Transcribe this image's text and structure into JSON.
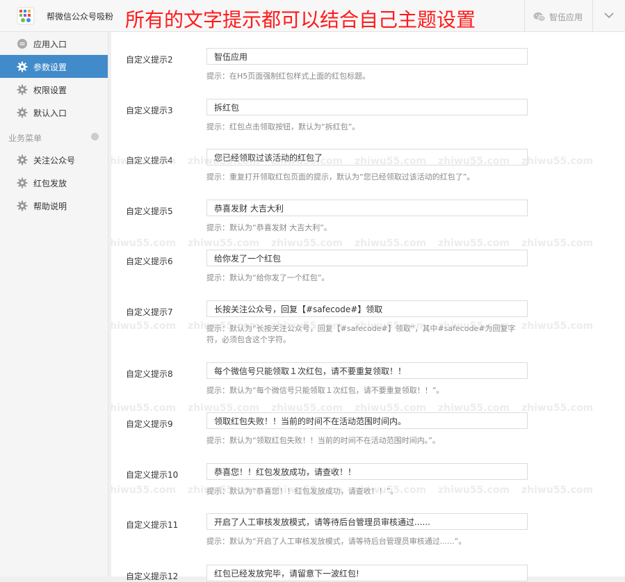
{
  "header": {
    "app_title": "帮微信公众号吸粉",
    "banner": "所有的文字提示都可以结合自己主题设置",
    "account_name": "智伍应用"
  },
  "sidebar": {
    "items": [
      {
        "label": "应用入口",
        "icon": "chat-bubble-icon",
        "active": false
      },
      {
        "label": "参数设置",
        "icon": "gear-icon",
        "active": true
      },
      {
        "label": "权限设置",
        "icon": "gear-icon",
        "active": false
      },
      {
        "label": "默认入口",
        "icon": "gear-icon",
        "active": false
      }
    ],
    "group_title": "业务菜单",
    "group_items": [
      {
        "label": "关注公众号",
        "icon": "gear-icon"
      },
      {
        "label": "红包发放",
        "icon": "gear-icon"
      },
      {
        "label": "帮助说明",
        "icon": "gear-icon"
      }
    ]
  },
  "form": {
    "rows": [
      {
        "label": "自定义提示2",
        "value": "智伍应用",
        "hint": "提示：在H5页面强制红包样式上面的红包标题。"
      },
      {
        "label": "自定义提示3",
        "value": "拆红包",
        "hint": "提示：红包点击领取按钮，默认为“拆红包”。"
      },
      {
        "label": "自定义提示4",
        "value": "您已经领取过该活动的红包了",
        "hint": "提示：重复打开领取红包页面的提示，默认为“您已经领取过该活动的红包了”。"
      },
      {
        "label": "自定义提示5",
        "value": "恭喜发财 大吉大利",
        "hint": "提示：默认为“恭喜发财 大吉大利”。"
      },
      {
        "label": "自定义提示6",
        "value": "给你发了一个红包",
        "hint": "提示：默认为“给你发了一个红包”。"
      },
      {
        "label": "自定义提示7",
        "value": "长按关注公众号，回复【#safecode#】领取",
        "hint": "提示：默认为“长按关注公众号，回复【#safecode#】领取”，其中#safecode#为回复字符，必须包含这个字符。"
      },
      {
        "label": "自定义提示8",
        "value": "每个微信号只能领取１次红包，请不要重复领取！！",
        "hint": "提示：默认为“每个微信号只能领取１次红包，请不要重复领取！！”。"
      },
      {
        "label": "自定义提示9",
        "value": "领取红包失败！！当前的时间不在活动范围时间内。",
        "hint": "提示：默认为“领取红包失败！！当前的时间不在活动范围时间内。”。"
      },
      {
        "label": "自定义提示10",
        "value": "恭喜您！！红包发放成功，请查收！！",
        "hint": "提示：默认为“恭喜您！！红包发放成功，请查收！！”。"
      },
      {
        "label": "自定义提示11",
        "value": "开启了人工审核发放模式，请等待后台管理员审核通过......",
        "hint": "提示：默认为“开启了人工审核发放模式，请等待后台管理员审核通过......”。"
      },
      {
        "label": "自定义提示12",
        "value": "红包已经发放完毕，请留意下一波红包!",
        "hint": ""
      }
    ]
  },
  "watermark": {
    "text": "zhiwu55.com"
  },
  "colors": {
    "banner": "#ff1a1a",
    "sidebar_active": "#428bca",
    "hint": "#888888"
  }
}
